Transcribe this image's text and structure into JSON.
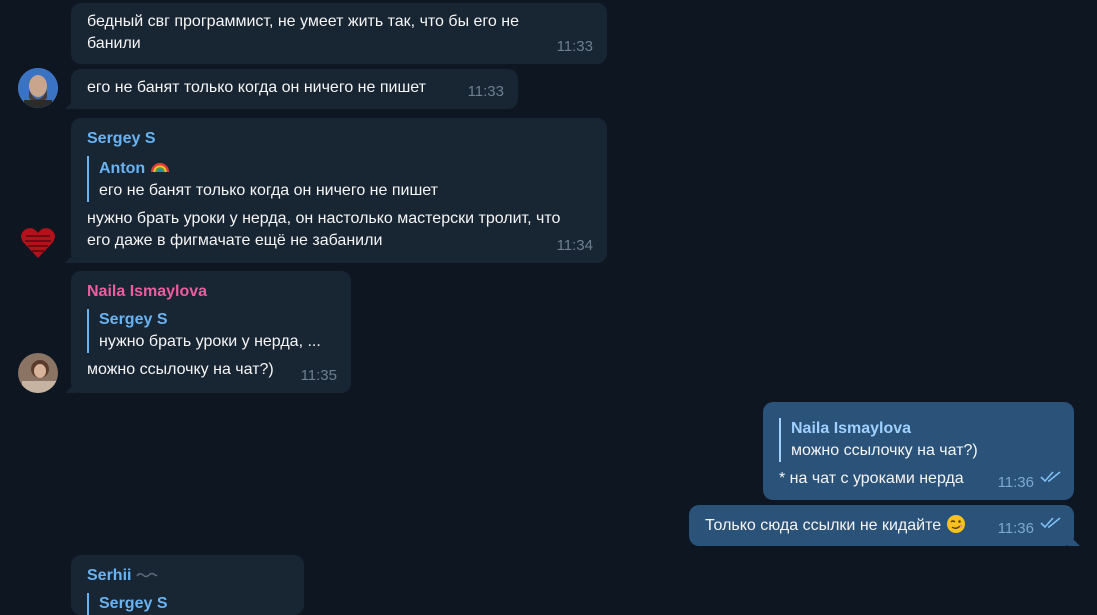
{
  "colors": {
    "background": "#0e1621",
    "incoming_bubble": "#182533",
    "outgoing_bubble": "#2b5278",
    "sergey_name": "#6ab3f3",
    "naila_name": "#ee5d9e",
    "serhii_name": "#6ab3f3"
  },
  "messages": [
    {
      "text": "бедный свг программист, не умеет жить так, что бы его не\nбанили",
      "time": "11:33"
    },
    {
      "text": "его не банят только когда он ничего не пишет",
      "time": "11:33"
    },
    {
      "sender": "Sergey S",
      "reply": {
        "name": "Anton",
        "name_emoji": "rainbow-icon",
        "text": "его не банят только когда он ничего не пишет"
      },
      "text": "нужно брать уроки у нерда, он настолько мастерски тролит, что\nего даже в фигмачате ещё не забанили",
      "time": "11:34"
    },
    {
      "sender": "Naila Ismaylova",
      "reply": {
        "name": "Sergey S",
        "text": "нужно брать уроки у нерда, ..."
      },
      "text": "можно ссылочку на чат?)",
      "time": "11:35"
    },
    {
      "outgoing": true,
      "reply": {
        "name": "Naila Ismaylova",
        "text": "можно ссылочку на чат?)"
      },
      "text": "* на чат с уроками нерда",
      "time": "11:36"
    },
    {
      "outgoing": true,
      "text": "Только сюда ссылки не кидайте",
      "emoji": "wink-emoji",
      "time": "11:36"
    },
    {
      "sender": "Serhii",
      "reply": {
        "name": "Sergey S"
      }
    }
  ]
}
